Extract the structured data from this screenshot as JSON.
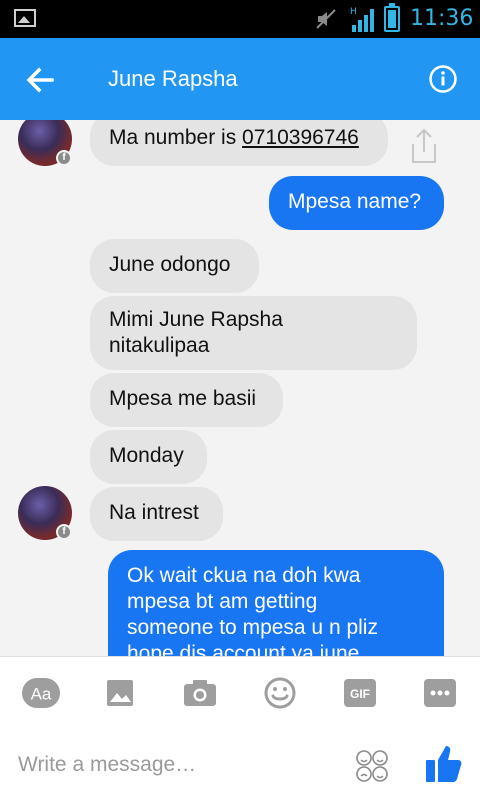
{
  "status_bar": {
    "time": "11:36",
    "network": "H"
  },
  "header": {
    "title": "June Rapsha",
    "back_icon": "arrow-left-icon",
    "info_icon": "info-icon"
  },
  "messages": [
    {
      "sender": "them",
      "text_prefix": "Ma number is ",
      "link": "0710396746",
      "avatar": true,
      "share": true
    },
    {
      "sender": "me",
      "text": "Mpesa name?"
    },
    {
      "sender": "them",
      "text": "June odongo"
    },
    {
      "sender": "them",
      "line1": "Mimi June Rapsha",
      "line2": "nitakulipaa"
    },
    {
      "sender": "them",
      "text": "Mpesa me basii"
    },
    {
      "sender": "them",
      "text": "Monday"
    },
    {
      "sender": "them",
      "text": "Na intrest",
      "avatar": true
    },
    {
      "sender": "me",
      "lines": [
        "Ok wait ckua na doh kwa",
        "mpesa bt am getting",
        "someone to mpesa u n pliz",
        "hope dis account ya june"
      ]
    }
  ],
  "toolbar": {
    "items": [
      {
        "icon": "text-format-icon",
        "label": "Aa"
      },
      {
        "icon": "image-icon"
      },
      {
        "icon": "camera-icon"
      },
      {
        "icon": "smiley-icon"
      },
      {
        "icon": "gif-icon",
        "label": "GIF"
      },
      {
        "icon": "more-icon"
      }
    ]
  },
  "composer": {
    "placeholder": "Write a message…",
    "emoji_icon": "emoji-grid-icon",
    "like_icon": "thumbs-up-icon"
  },
  "colors": {
    "primary": "#2196f3",
    "my_bubble": "#1976f2",
    "their_bubble": "#e4e4e4",
    "icon_gray": "#9e9e9e",
    "status_accent": "#33b5e5"
  }
}
